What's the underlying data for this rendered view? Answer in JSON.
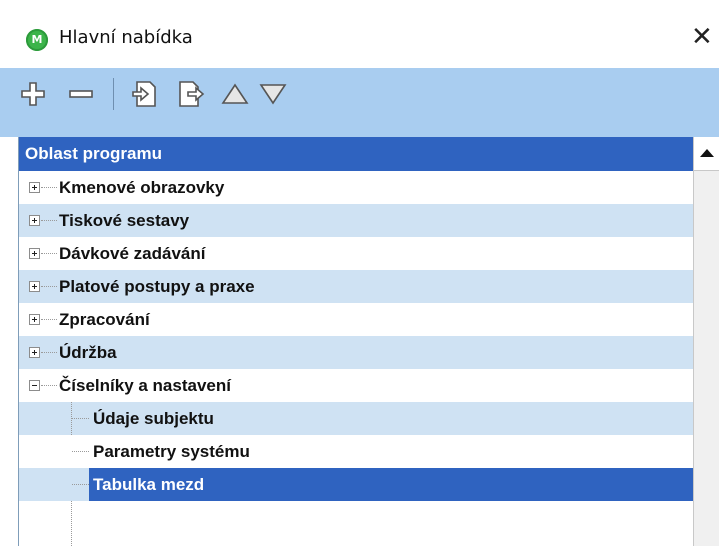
{
  "window": {
    "title": "Hlavní nabídka",
    "app_icon_letter": "M",
    "close_glyph": "✕"
  },
  "toolbar": {
    "buttons": [
      {
        "name": "add-icon"
      },
      {
        "name": "remove-icon"
      },
      {
        "name": "import-icon"
      },
      {
        "name": "export-icon"
      },
      {
        "name": "move-up-icon"
      },
      {
        "name": "move-down-icon"
      }
    ]
  },
  "tree": {
    "header": "Oblast programu",
    "items": [
      {
        "label": "Kmenové obrazovky",
        "expanded": false
      },
      {
        "label": "Tiskové sestavy",
        "expanded": false
      },
      {
        "label": "Dávkové zadávání",
        "expanded": false
      },
      {
        "label": "Platové postupy a praxe",
        "expanded": false
      },
      {
        "label": "Zpracování",
        "expanded": false
      },
      {
        "label": "Údržba",
        "expanded": false
      },
      {
        "label": "Číselníky a nastavení",
        "expanded": true
      }
    ],
    "children": [
      {
        "label": "Údaje subjektu"
      },
      {
        "label": "Parametry systému"
      },
      {
        "label": "Tabulka mezd",
        "selected": true
      }
    ]
  },
  "colors": {
    "toolbar_bg": "#a9cdf0",
    "header_bg": "#2f63c0",
    "row_alt_bg": "#cfe2f3",
    "selected_bg": "#2f63c0",
    "app_icon": "#3cb44a"
  }
}
